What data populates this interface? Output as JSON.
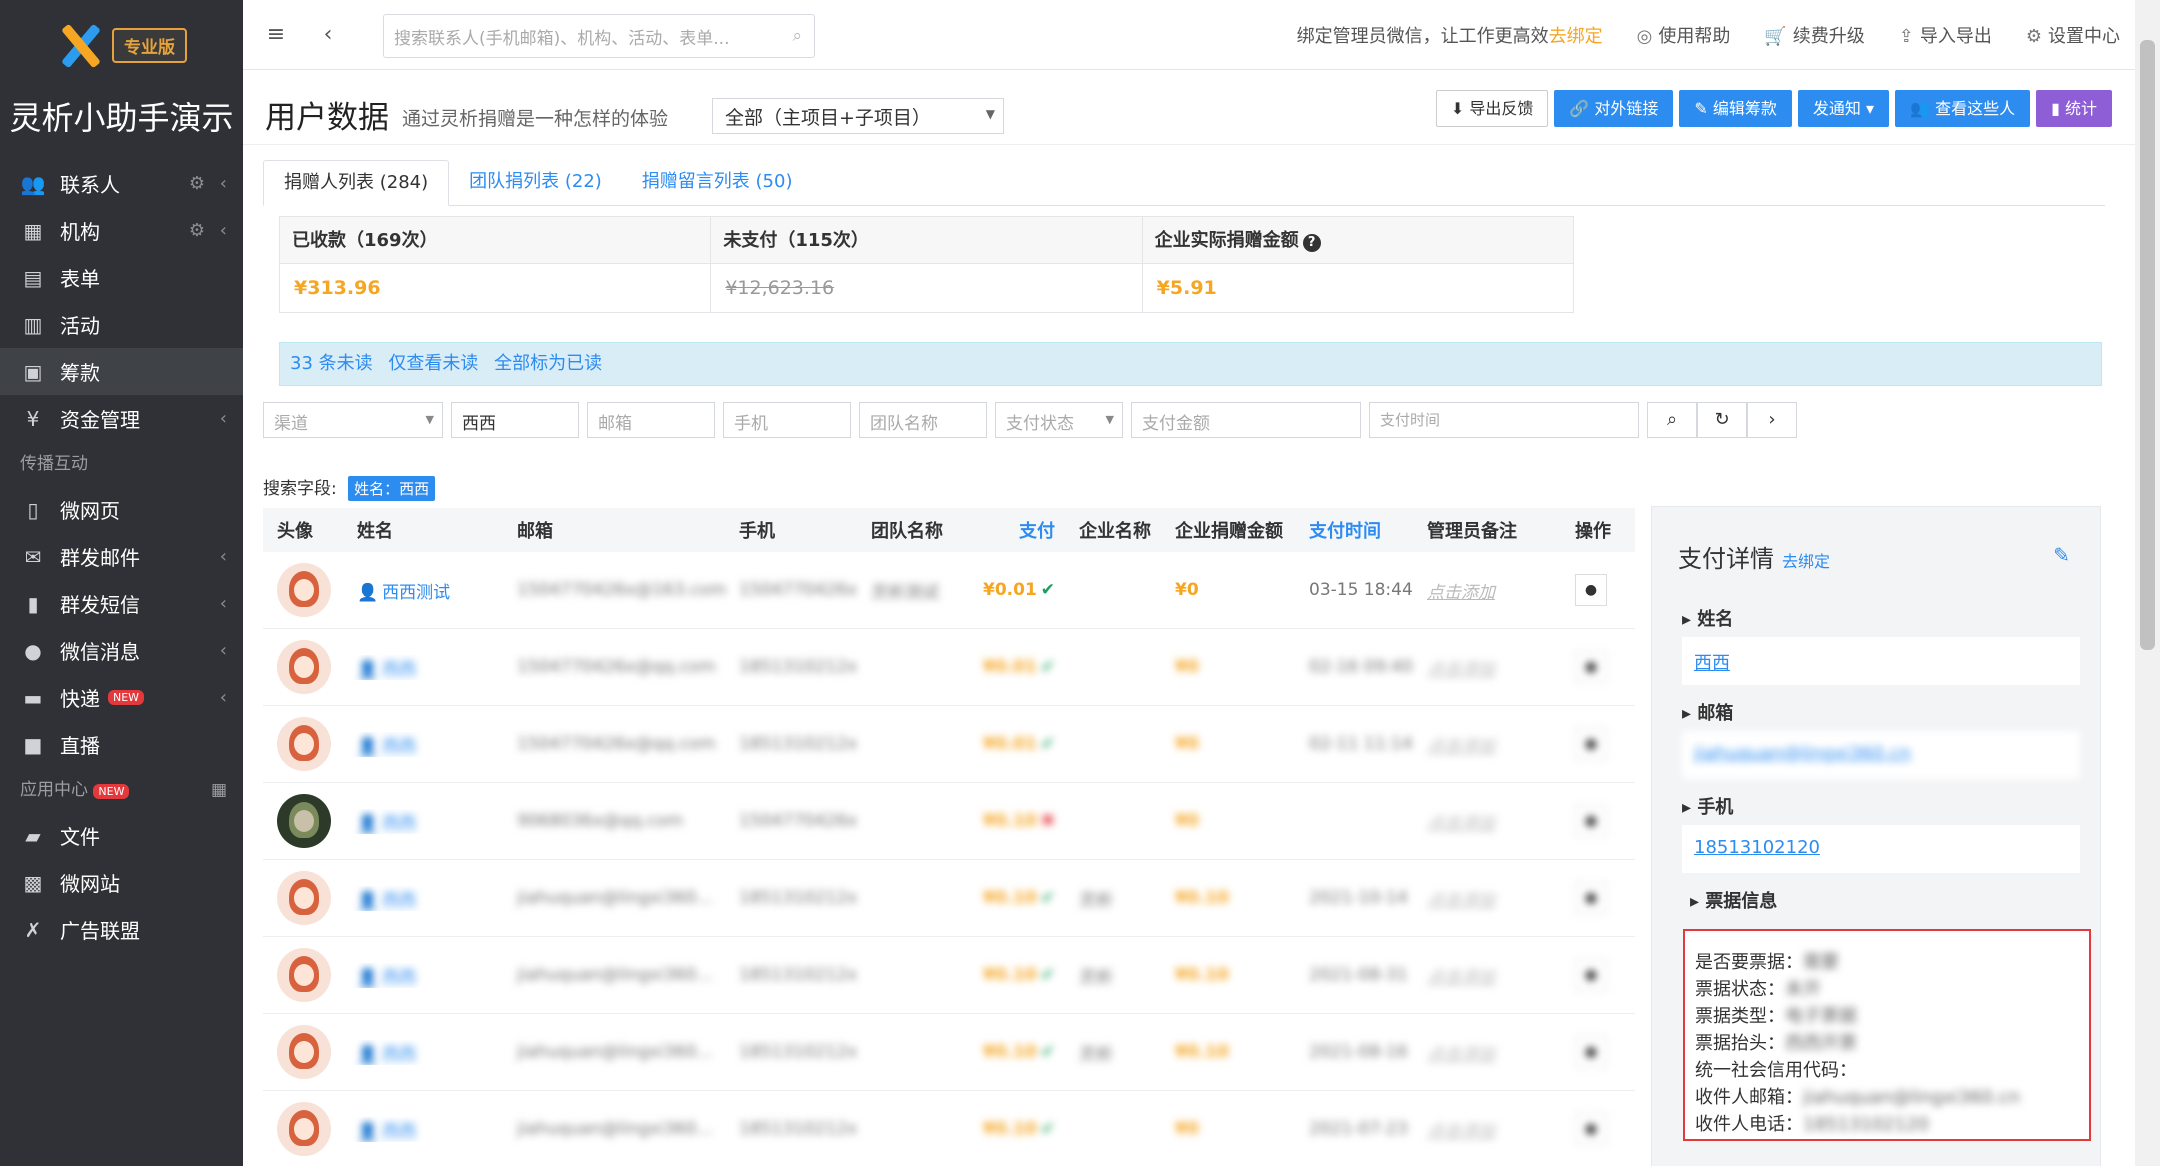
{
  "app": {
    "title": "灵析小助手演示",
    "edition": "专业版"
  },
  "sidebar": {
    "items": [
      {
        "label": "联系人",
        "icon": "users-icon"
      },
      {
        "label": "机构",
        "icon": "building-icon"
      },
      {
        "label": "表单",
        "icon": "clipboard-icon"
      },
      {
        "label": "活动",
        "icon": "calendar-icon"
      },
      {
        "label": "筹款",
        "icon": "wallet-icon"
      },
      {
        "label": "资金管理",
        "icon": "yen-icon"
      }
    ],
    "section_spread": "传播互动",
    "items2": [
      {
        "label": "微网页",
        "icon": "doc-icon"
      },
      {
        "label": "群发邮件",
        "icon": "mail-icon"
      },
      {
        "label": "群发短信",
        "icon": "phone-icon"
      },
      {
        "label": "微信消息",
        "icon": "wechat-icon"
      },
      {
        "label": "快递",
        "icon": "truck-icon",
        "badge": "NEW"
      },
      {
        "label": "直播",
        "icon": "video-icon"
      }
    ],
    "section_apps": "应用中心",
    "section_apps_badge": "NEW",
    "items3": [
      {
        "label": "文件",
        "icon": "folder-icon"
      },
      {
        "label": "微网站",
        "icon": "site-icon"
      },
      {
        "label": "广告联盟",
        "icon": "ads-icon"
      }
    ]
  },
  "topbar": {
    "search_placeholder": "搜索联系人(手机邮箱)、机构、活动、表单...",
    "bind_text": "绑定管理员微信，让工作更高效",
    "bind_link": "去绑定",
    "help": "使用帮助",
    "upgrade": "续费升级",
    "import_export": "导入导出",
    "settings": "设置中心"
  },
  "header": {
    "title": "用户数据",
    "subtitle": "通过灵析捐赠是一种怎样的体验",
    "scope": "全部（主项目+子项目）",
    "buttons": {
      "export": "导出反馈",
      "external_link": "对外链接",
      "edit_fund": "编辑筹款",
      "send_notice": "发通知",
      "view_people": "查看这些人",
      "stats": "统计"
    }
  },
  "tabs": [
    {
      "label": "捐赠人列表 (284)"
    },
    {
      "label": "团队捐列表 (22)"
    },
    {
      "label": "捐赠留言列表 (50)"
    }
  ],
  "stats": {
    "paid_label": "已收款（169次）",
    "paid_value": "¥313.96",
    "unpaid_label": "未支付（115次）",
    "unpaid_value": "¥12,623.16",
    "corp_label": "企业实际捐赠金额",
    "corp_value": "¥5.91"
  },
  "notice": {
    "unread": "33 条未读",
    "only_unread": "仅查看未读",
    "mark_all": "全部标为已读"
  },
  "filters": {
    "channel": "渠道",
    "name": "西西",
    "email": "邮箱",
    "phone": "手机",
    "team": "团队名称",
    "pay_status": "支付状态",
    "pay_amount": "支付金额",
    "pay_time": "支付时间"
  },
  "search_fields": {
    "label": "搜索字段:",
    "tag": "姓名：西西"
  },
  "table": {
    "headers": {
      "avatar": "头像",
      "name": "姓名",
      "email": "邮箱",
      "phone": "手机",
      "team": "团队名称",
      "pay": "支付",
      "company": "企业名称",
      "corp_amount": "企业捐赠金额",
      "pay_time": "支付时间",
      "admin_note": "管理员备注",
      "ops": "操作"
    },
    "rows": [
      {
        "name": "西西测试",
        "email": "1504770426x@163.com",
        "phone": "1504770426x",
        "team": "灵析测试",
        "pay": "¥0.01",
        "status": "ok",
        "company": "",
        "corp": "¥0",
        "time": "03-15 18:44",
        "note": "点击添加",
        "blur": false,
        "dark": false
      },
      {
        "name": "西西",
        "email": "1504770426x@qq.com",
        "phone": "1851310212x",
        "team": "",
        "pay": "¥0.01",
        "status": "ok",
        "company": "",
        "corp": "¥0",
        "time": "02-16 09:40",
        "note": "点击添加",
        "blur": true,
        "dark": false
      },
      {
        "name": "西西",
        "email": "1504770426x@qq.com",
        "phone": "1851310212x",
        "team": "",
        "pay": "¥0.01",
        "status": "ok",
        "company": "",
        "corp": "¥0",
        "time": "02-11 11:14",
        "note": "点击添加",
        "blur": true,
        "dark": false
      },
      {
        "name": "西西",
        "email": "9068036x@qq.com",
        "phone": "1504770426x",
        "team": "",
        "pay": "¥0.10",
        "status": "no",
        "company": "",
        "corp": "¥0",
        "time": "",
        "note": "点击添加",
        "blur": true,
        "dark": true
      },
      {
        "name": "西西",
        "email": "jiahuquan@lingxi360...",
        "phone": "1851310212x",
        "team": "",
        "pay": "¥0.10",
        "status": "ok",
        "company": "灵析",
        "corp": "¥0.10",
        "time": "2021-10-14",
        "note": "点击添加",
        "blur": true,
        "dark": false
      },
      {
        "name": "西西",
        "email": "jiahuquan@lingxi360...",
        "phone": "1851310212x",
        "team": "",
        "pay": "¥0.10",
        "status": "ok",
        "company": "灵析",
        "corp": "¥0.10",
        "time": "2021-08-31",
        "note": "点击添加",
        "blur": true,
        "dark": false
      },
      {
        "name": "西西",
        "email": "jiahuquan@lingxi360...",
        "phone": "1851310212x",
        "team": "",
        "pay": "¥0.10",
        "status": "ok",
        "company": "灵析",
        "corp": "¥0.10",
        "time": "2021-08-16",
        "note": "点击添加",
        "blur": true,
        "dark": false
      },
      {
        "name": "西西",
        "email": "jiahuquan@lingxi360...",
        "phone": "1851310212x",
        "team": "",
        "pay": "¥0.10",
        "status": "ok",
        "company": "",
        "corp": "¥0",
        "time": "2021-07-23",
        "note": "点击添加",
        "blur": true,
        "dark": false
      }
    ]
  },
  "detail": {
    "title": "支付详情",
    "bind": "去绑定",
    "name_label": "姓名",
    "name_value": "西西",
    "email_label": "邮箱",
    "email_value": "jiahuquan@lingxi360.cn",
    "phone_label": "手机",
    "phone_value": "18513102120",
    "invoice_label": "票据信息",
    "invoice": [
      {
        "k": "是否要票据：",
        "v": "需要"
      },
      {
        "k": "票据状态：",
        "v": "未开"
      },
      {
        "k": "票据类型：",
        "v": "电子票据"
      },
      {
        "k": "票据抬头：",
        "v": "西西开票"
      },
      {
        "k": "统一社会信用代码：",
        "v": ""
      },
      {
        "k": "收件人邮箱：",
        "v": "jiahuquan@lingxi360.cn"
      },
      {
        "k": "收件人电话：",
        "v": "18513102120"
      }
    ]
  },
  "colors": {
    "accent": "#2d8cf0",
    "money": "#f5a623",
    "sidebar": "#2f3136",
    "highlight_border": "#e4393c"
  }
}
